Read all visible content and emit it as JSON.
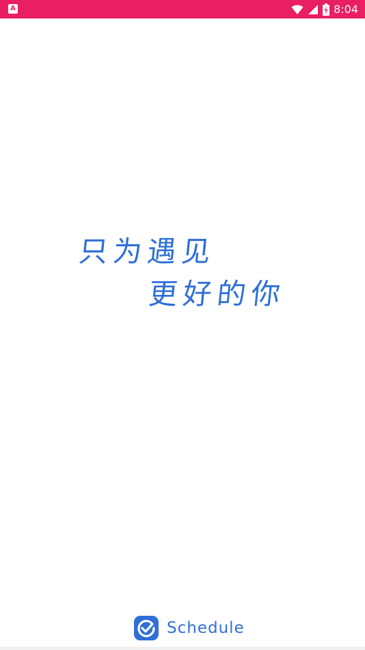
{
  "status_bar": {
    "notification_icon": "a-app-icon",
    "icons": [
      "wifi-icon",
      "signal-icon",
      "battery-charging-icon"
    ],
    "time": "8:04",
    "color": "#e91e63"
  },
  "splash": {
    "slogan_line1": "只为遇见",
    "slogan_line2": "更好的你",
    "accent_color": "#2f6fd6"
  },
  "brand": {
    "logo_icon": "checkmark-icon",
    "name": "Schedule"
  }
}
